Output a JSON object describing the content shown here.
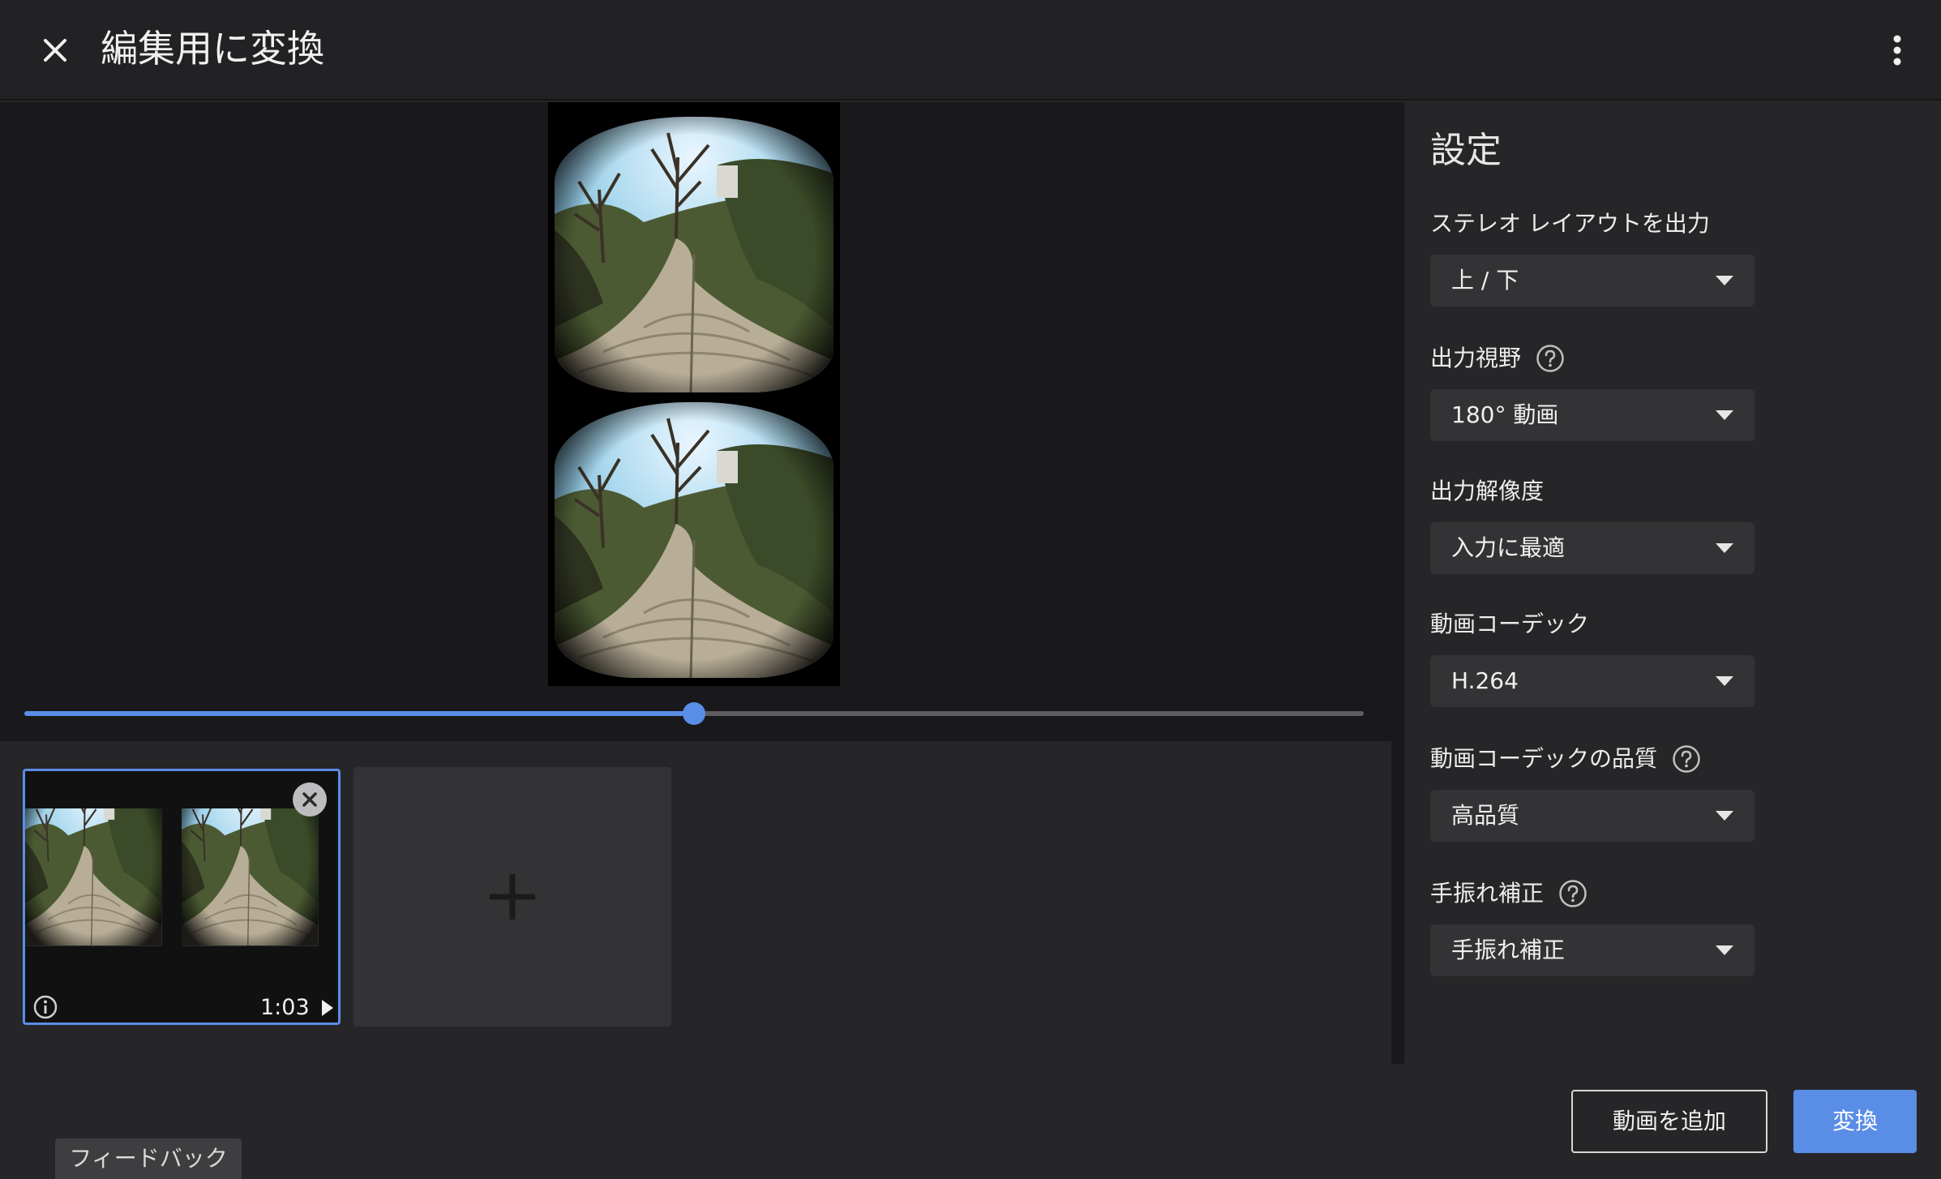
{
  "header": {
    "title": "編集用に変換",
    "close_icon": "close-icon",
    "menu_icon": "more-vert-icon"
  },
  "preview": {
    "layout": "top-bottom stereo",
    "progress": 0.5,
    "accent_color": "#5a8de6"
  },
  "clips": [
    {
      "duration": "1:03",
      "selected": true
    }
  ],
  "add_clip_icon": "plus-icon",
  "settings": {
    "title": "設定",
    "fields": [
      {
        "label": "ステレオ レイアウトを出力",
        "value": "上 / 下",
        "help": false
      },
      {
        "label": "出力視野",
        "value": "180° 動画",
        "help": true
      },
      {
        "label": "出力解像度",
        "value": "入力に最適",
        "help": false
      },
      {
        "label": "動画コーデック",
        "value": "H.264",
        "help": false
      },
      {
        "label": "動画コーデックの品質",
        "value": "高品質",
        "help": true
      },
      {
        "label": "手振れ補正",
        "value": "手振れ補正",
        "help": true
      }
    ]
  },
  "footer": {
    "feedback_label": "フィードバック",
    "add_video_label": "動画を追加",
    "convert_label": "変換"
  },
  "colors": {
    "background": "#262628",
    "preview_bg": "#19191b",
    "accent": "#5a8de6",
    "select_bg": "#333336"
  }
}
